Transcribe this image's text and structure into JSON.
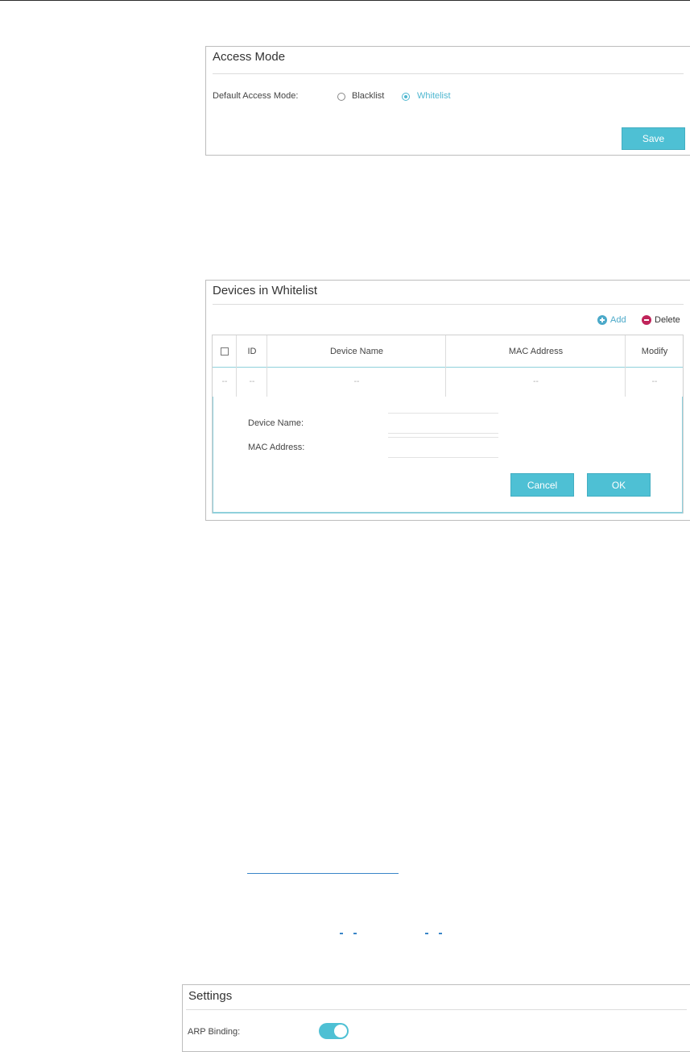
{
  "access_mode": {
    "title": "Access Mode",
    "default_label": "Default Access Mode:",
    "options": [
      {
        "label": "Blacklist",
        "selected": false
      },
      {
        "label": "Whitelist",
        "selected": true
      }
    ],
    "save_label": "Save"
  },
  "devices": {
    "title": "Devices in Whitelist",
    "add_label": "Add",
    "delete_label": "Delete",
    "columns": [
      "ID",
      "Device Name",
      "MAC Address",
      "Modify"
    ],
    "empty_row": [
      "--",
      "--",
      "--",
      "--",
      "--"
    ],
    "form": {
      "device_name_label": "Device Name:",
      "device_name_value": "",
      "mac_label": "MAC Address:",
      "mac_value": "",
      "cancel_label": "Cancel",
      "ok_label": "OK"
    }
  },
  "settings": {
    "title": "Settings",
    "arp_label": "ARP Binding:",
    "arp_enabled": true
  },
  "colors": {
    "accent": "#4ec0d4",
    "add_icon": "#4ba9c9",
    "delete_icon": "#c0245a",
    "link": "#3a86c8"
  }
}
